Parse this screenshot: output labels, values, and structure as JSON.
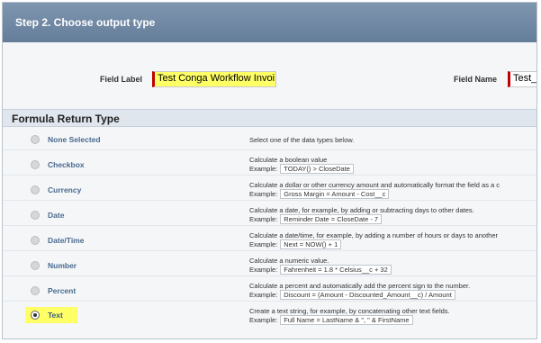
{
  "step": {
    "title": "Step 2. Choose output type"
  },
  "field": {
    "label": "Field Label",
    "value": "Test Conga Workflow Invoi",
    "name_label": "Field Name",
    "name_value": "Test_C"
  },
  "section": {
    "title": "Formula Return Type"
  },
  "example_prefix": "Example:",
  "options": [
    {
      "label": "None Selected",
      "selected": false,
      "description": "Select one of the data types below.",
      "example": ""
    },
    {
      "label": "Checkbox",
      "selected": false,
      "description": "Calculate a boolean value",
      "example": "TODAY() > CloseDate"
    },
    {
      "label": "Currency",
      "selected": false,
      "description": "Calculate a dollar or other currency amount and automatically format the field as a c",
      "example": "Gross Margin = Amount - Cost__c"
    },
    {
      "label": "Date",
      "selected": false,
      "description": "Calculate a date, for example, by adding or subtracting days to other dates.",
      "example": "Reminder Date = CloseDate - 7"
    },
    {
      "label": "Date/Time",
      "selected": false,
      "description": "Calculate a date/time, for example, by adding a number of hours or days to another",
      "example": "Next = NOW() + 1"
    },
    {
      "label": "Number",
      "selected": false,
      "description": "Calculate a numeric value.",
      "example": "Fahrenheit = 1.8 * Celsius__c + 32"
    },
    {
      "label": "Percent",
      "selected": false,
      "description": "Calculate a percent and automatically add the percent sign to the number.",
      "example": "Discount = (Amount - Discounted_Amount__c) / Amount"
    },
    {
      "label": "Text",
      "selected": true,
      "description": "Create a text string, for example, by concatenating other text fields.",
      "example": "Full Name = LastName & \", \" & FirstName"
    }
  ],
  "colors": {
    "header": "#6e87a3",
    "highlight": "#ffff66",
    "required": "#c00000",
    "option_label": "#4a6a8f"
  }
}
